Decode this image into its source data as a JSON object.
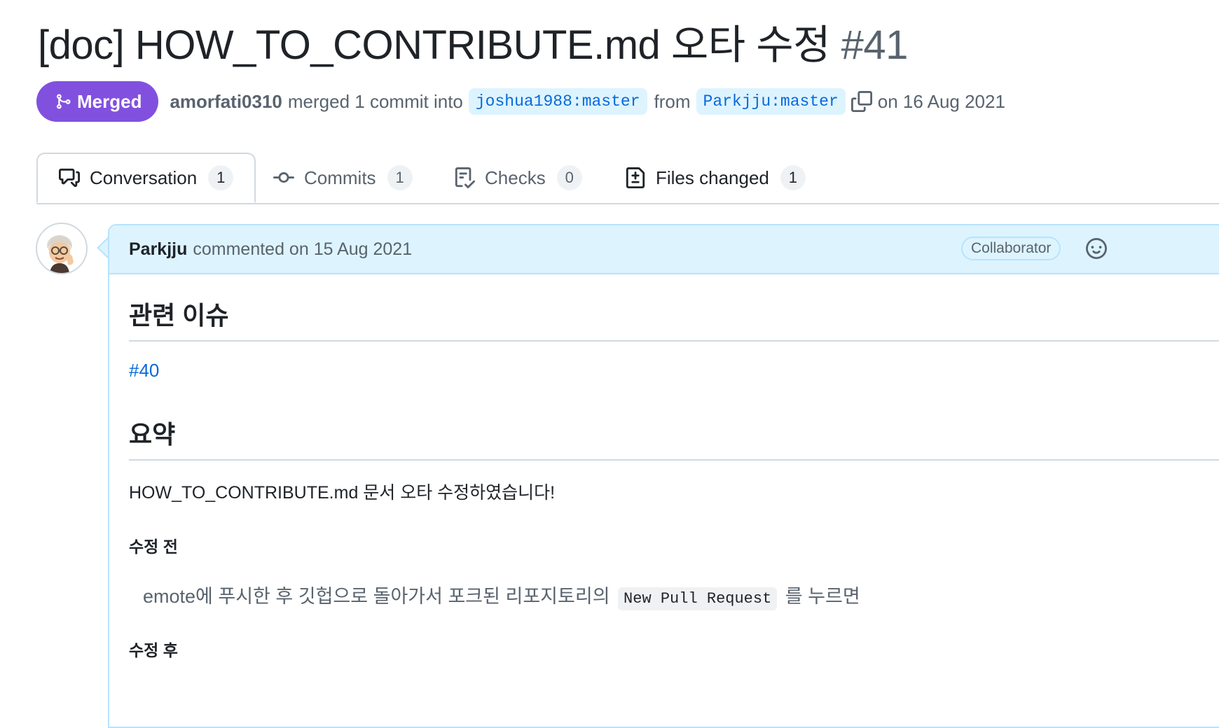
{
  "pr": {
    "title": "[doc] HOW_TO_CONTRIBUTE.md 오타 수정",
    "number": "#41",
    "state": "Merged",
    "author": "amorfati0310",
    "merged_text": "merged 1 commit into",
    "base_branch": "joshua1988:master",
    "from_text": "from",
    "head_branch": "Parkjju:master",
    "date_text": "on 16 Aug 2021"
  },
  "tabs": [
    {
      "label": "Conversation",
      "count": "1"
    },
    {
      "label": "Commits",
      "count": "1"
    },
    {
      "label": "Checks",
      "count": "0"
    },
    {
      "label": "Files changed",
      "count": "1"
    }
  ],
  "comment": {
    "author": "Parkjju",
    "meta": "commented on 15 Aug 2021",
    "badge": "Collaborator",
    "heading1": "관련 이슈",
    "issue_link": "#40",
    "heading2": "요약",
    "summary": "HOW_TO_CONTRIBUTE.md 문서 오타 수정하였습니다!",
    "before_label": "수정 전",
    "before_text_pre": "emote에 푸시한 후 깃헙으로 돌아가서 포크된 리포지토리의",
    "before_code": "New Pull Request",
    "before_text_post": "를 누르면",
    "after_label": "수정 후"
  },
  "colors": {
    "merged": "#8250df",
    "link": "#0969da",
    "header_bg": "#ddf4ff"
  }
}
